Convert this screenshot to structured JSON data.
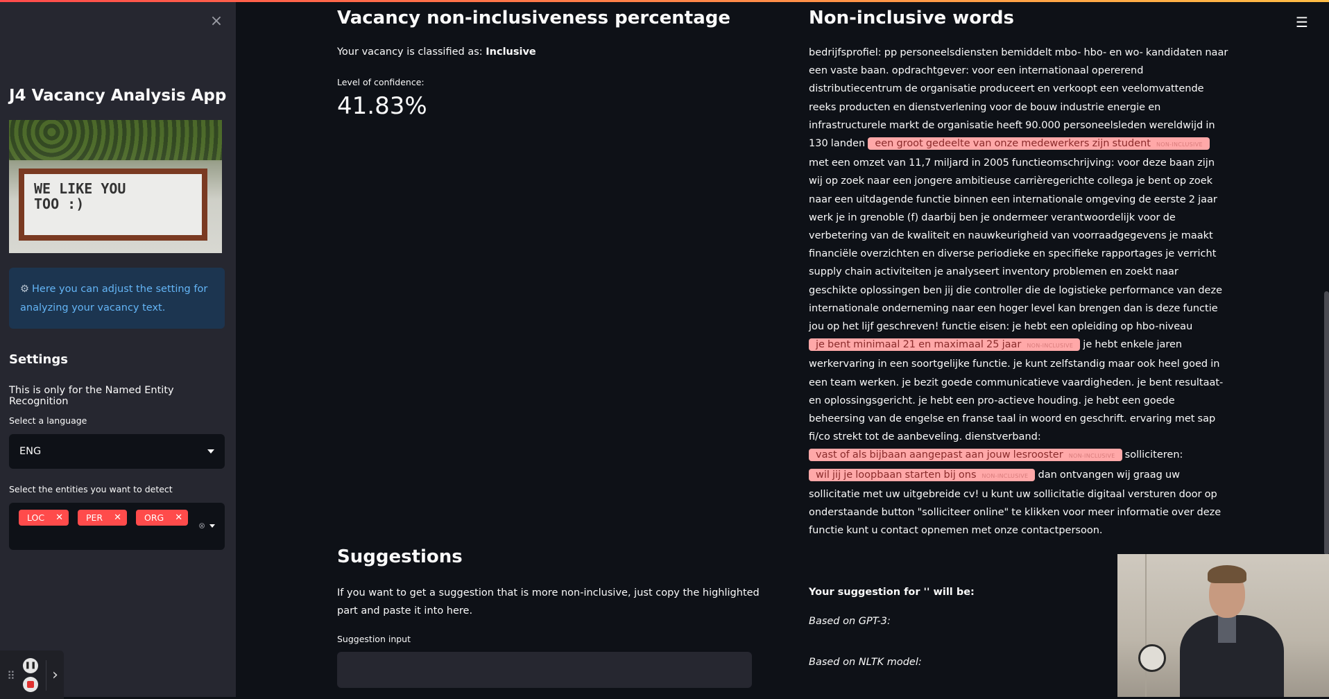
{
  "sidebar": {
    "close": "×",
    "app_title": "J4 Vacancy Analysis App",
    "image_text": "WE LIKE YOU\nTOO :)",
    "info": "Here you can adjust the setting for analyzing your vacancy text.",
    "settings_heading": "Settings",
    "settings_note": "This is only for the Named Entity Recognition",
    "language_label": "Select a language",
    "language_value": "ENG",
    "entities_label": "Select the entities you want to detect",
    "entities": [
      "LOC",
      "PER",
      "ORG"
    ]
  },
  "main": {
    "vacancy_heading": "Vacancy non-inclusiveness percentage",
    "classified_prefix": "Your vacancy is classified as: ",
    "classified_value": "Inclusive",
    "confidence_label": "Level of confidence:",
    "confidence_value": "41.83%",
    "noninclusive_heading": "Non-inclusive words",
    "highlight_label": "NON-INCLUSIVE",
    "text": {
      "t1": "bedrijfsprofiel: pp personeelsdiensten bemiddelt mbo- hbo- en wo- kandidaten naar een vaste baan. opdrachtgever: voor een internationaal opererend distributiecentrum de organisatie produceert en verkoopt een veelomvattende reeks producten en dienstverlening voor de bouw industrie energie en infrastructurele markt de organisatie heeft 90.000 personeelsleden wereldwijd in 130 landen ",
      "h1": "een groot gedeelte van onze medewerkers zijn student",
      "t2": " met een omzet van 11,7 miljard in 2005 functieomschrijving: voor deze baan zijn wij op zoek naar een jongere ambitieuse carrièregerichte collega je bent op zoek naar een uitdagende functie binnen een internationale omgeving de eerste 2 jaar werk je in grenoble (f) daarbij ben je ondermeer verantwoordelijk voor de verbetering van de kwaliteit en nauwkeurigheid van voorraadgegevens je maakt financiële overzichten en diverse periodieke en specifieke rapportages je verricht supply chain activiteiten je analyseert inventory problemen en zoekt naar geschikte oplossingen ben jij die controller die de logistieke performance van deze internationale onderneming naar een hoger level kan brengen dan is deze functie jou op het lijf geschreven! functie eisen: je hebt een opleiding op hbo-niveau ",
      "h2": "je bent minimaal 21 en maximaal 25 jaar",
      "t3": " je hebt enkele jaren werkervaring in een soortgelijke functie. je kunt zelfstandig maar ook heel goed in een team werken. je bezit goede communicatieve vaardigheden. je bent resultaat- en oplossingsgericht. je hebt een pro-actieve houding. je hebt een goede beheersing van de engelse en franse taal in woord en geschrift. ervaring met sap fi/co strekt tot de aanbeveling. dienstverband: ",
      "h3": "vast of als bijbaan aangepast aan jouw lesrooster",
      "t4": " solliciteren: ",
      "h4": "wil jij je loopbaan starten bij ons",
      "t5": " dan ontvangen wij graag uw sollicitatie met uw uitgebreide cv! u kunt uw sollicitatie digitaal versturen door op onderstaande button \"solliciteer online\" te klikken voor meer informatie over deze functie kunt u contact opnemen met onze contactpersoon."
    },
    "suggestions_heading": "Suggestions",
    "suggestions_desc": "If you want to get a suggestion that is more non-inclusive, just copy the highlighted part and paste it into here.",
    "suggestion_input_label": "Suggestion input",
    "suggestion_input_value": "",
    "your_suggestion": "Your suggestion for '' will be:",
    "based_gpt": "Based on GPT-3:",
    "based_nltk": "Based on NLTK model:"
  },
  "icons": {
    "close": "close-icon",
    "info": "gear-icon",
    "menu": "hamburger-menu-icon"
  },
  "colors": {
    "background": "#0e1117",
    "sidebar": "#262730",
    "accent": "#ff4b4b",
    "highlight": "#ffa8a8",
    "info_text": "#64b5f6"
  }
}
